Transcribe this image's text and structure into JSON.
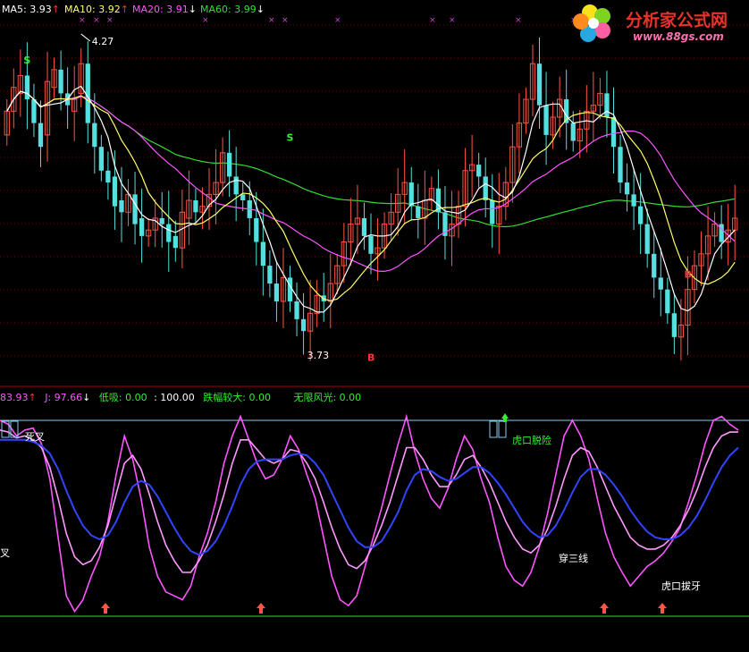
{
  "top_header": {
    "ma5": {
      "label": "MA5: 3.93",
      "arrow": "↑",
      "color": "#ffffff"
    },
    "ma10": {
      "label": "MA10: 3.92",
      "arrow": "↑",
      "color": "#ffff66"
    },
    "ma20": {
      "label": "MA20: 3.91",
      "arrow": "↓",
      "color": "#ff55ff"
    },
    "ma60": {
      "label": "MA60: 3.99",
      "arrow": "↓",
      "color": "#33dd33"
    }
  },
  "logo": {
    "title": "分析家公式网",
    "url": "www.88gs.com"
  },
  "price_panel": {
    "high_label": "4.27",
    "low_label": "3.73",
    "signals": [
      "S",
      "S",
      "B",
      "B"
    ],
    "ymin": 3.68,
    "ymax": 4.3
  },
  "bottom_header": {
    "k": "83.93",
    "k_arrow": "↑",
    "j": "J: 97.66",
    "j_arrow": "↓",
    "low_suck": "低吸: 0.00",
    "hundred": ": 100.00",
    "drop": "跌幅较大: 0.00",
    "wuxian": "无限风光: 0.00"
  },
  "annotations": {
    "sicha": "死叉",
    "cha_left": "叉",
    "hukou_tuoxian": "虎口脱险",
    "chuansanxian": "穿三线",
    "hukou_baya": "虎口拔牙"
  },
  "chart_data": [
    {
      "type": "candlestick",
      "title": "",
      "ylim": [
        3.68,
        4.3
      ],
      "grid": "horizontal dotted red lines",
      "series": [
        {
          "name": "MA5",
          "color": "#ffffff"
        },
        {
          "name": "MA10",
          "color": "#ffff66"
        },
        {
          "name": "MA20",
          "color": "#ff55ff"
        },
        {
          "name": "MA60",
          "color": "#33dd33"
        }
      ],
      "close": [
        4.14,
        4.18,
        4.2,
        4.16,
        4.12,
        4.08,
        4.19,
        4.21,
        4.17,
        4.15,
        4.16,
        4.22,
        4.12,
        4.08,
        4.04,
        4.02,
        3.98,
        3.97,
        4.0,
        3.95,
        3.93,
        3.94,
        3.96,
        3.95,
        3.92,
        3.91,
        3.97,
        3.99,
        3.97,
        3.98,
        4.0,
        4.02,
        4.07,
        4.03,
        4.0,
        3.99,
        3.96,
        3.92,
        3.88,
        3.85,
        3.82,
        3.86,
        3.82,
        3.79,
        3.77,
        3.8,
        3.83,
        3.82,
        3.85,
        3.88,
        3.92,
        3.95,
        3.96,
        3.93,
        3.9,
        3.91,
        3.95,
        3.97,
        4.0,
        4.02,
        3.98,
        3.96,
        3.99,
        4.01,
        3.97,
        3.93,
        3.95,
        3.98,
        4.04,
        4.05,
        4.03,
        3.99,
        3.95,
        3.98,
        4.02,
        4.08,
        4.12,
        4.16,
        4.22,
        4.15,
        4.1,
        4.13,
        4.16,
        4.12,
        4.09,
        4.11,
        4.14,
        4.15,
        4.17,
        4.13,
        4.08,
        4.02,
        4.0,
        3.98,
        3.95,
        3.9,
        3.86,
        3.84,
        3.8,
        3.76,
        3.78,
        3.84,
        3.88,
        3.9,
        3.93,
        3.95,
        3.92,
        3.94,
        3.96
      ],
      "open": [
        4.1,
        4.14,
        4.17,
        4.2,
        4.16,
        4.12,
        4.1,
        4.18,
        4.21,
        4.17,
        4.14,
        4.17,
        4.22,
        4.12,
        4.08,
        4.04,
        4.03,
        3.99,
        3.97,
        4.0,
        3.96,
        3.93,
        3.94,
        3.96,
        3.95,
        3.93,
        3.91,
        3.96,
        3.99,
        3.97,
        3.98,
        4.0,
        4.02,
        4.07,
        4.03,
        4.0,
        3.99,
        3.96,
        3.92,
        3.88,
        3.85,
        3.82,
        3.86,
        3.82,
        3.79,
        3.77,
        3.8,
        3.83,
        3.82,
        3.85,
        3.88,
        3.92,
        3.95,
        3.96,
        3.93,
        3.9,
        3.91,
        3.95,
        3.97,
        4.0,
        4.02,
        3.98,
        3.96,
        3.99,
        4.01,
        3.97,
        3.93,
        3.95,
        3.98,
        4.04,
        4.05,
        4.03,
        3.99,
        3.95,
        3.98,
        4.02,
        4.08,
        4.12,
        4.16,
        4.22,
        4.15,
        4.1,
        4.13,
        4.16,
        4.12,
        4.09,
        4.11,
        4.14,
        4.15,
        4.17,
        4.13,
        4.08,
        4.02,
        4.0,
        3.98,
        3.95,
        3.9,
        3.86,
        3.84,
        3.8,
        3.76,
        3.78,
        3.84,
        3.88,
        3.9,
        3.93,
        3.95,
        3.92,
        3.94
      ],
      "high_point": 4.27,
      "low_point": 3.73
    },
    {
      "type": "line",
      "title": "",
      "ylim": [
        0,
        100
      ],
      "series": [
        {
          "name": "J",
          "color": "#ff55ff",
          "values": [
            100,
            98,
            92,
            95,
            96,
            88,
            70,
            40,
            10,
            2,
            8,
            20,
            30,
            48,
            72,
            92,
            80,
            60,
            35,
            20,
            12,
            10,
            8,
            15,
            30,
            42,
            58,
            78,
            92,
            102,
            90,
            78,
            70,
            72,
            80,
            92,
            85,
            72,
            60,
            40,
            20,
            8,
            5,
            10,
            25,
            40,
            55,
            72,
            88,
            102,
            84,
            70,
            60,
            55,
            65,
            80,
            92,
            85,
            70,
            58,
            40,
            25,
            18,
            15,
            22,
            35,
            52,
            72,
            92,
            100,
            92,
            80,
            60,
            42,
            30,
            22,
            15,
            20,
            25,
            28,
            32,
            38,
            45,
            58,
            72,
            88,
            100,
            102,
            98,
            95
          ]
        },
        {
          "name": "K",
          "color": "#ff99ff",
          "values": [
            95,
            94,
            91,
            92,
            90,
            86,
            76,
            60,
            42,
            30,
            26,
            28,
            35,
            46,
            62,
            78,
            82,
            75,
            62,
            48,
            36,
            28,
            22,
            22,
            28,
            36,
            48,
            62,
            78,
            90,
            90,
            85,
            80,
            78,
            80,
            85,
            84,
            78,
            70,
            58,
            45,
            34,
            26,
            24,
            28,
            36,
            46,
            58,
            72,
            86,
            86,
            80,
            72,
            66,
            66,
            72,
            80,
            82,
            76,
            68,
            58,
            48,
            40,
            34,
            32,
            36,
            44,
            56,
            70,
            82,
            86,
            84,
            76,
            66,
            56,
            48,
            40,
            36,
            34,
            34,
            36,
            40,
            46,
            54,
            64,
            76,
            86,
            92,
            94,
            94
          ]
        },
        {
          "name": "D",
          "color": "#3344ff",
          "values": [
            90,
            90,
            90,
            90,
            89,
            87,
            83,
            75,
            64,
            54,
            46,
            41,
            39,
            41,
            48,
            58,
            66,
            69,
            67,
            61,
            53,
            45,
            38,
            33,
            31,
            33,
            38,
            46,
            56,
            67,
            75,
            79,
            80,
            80,
            80,
            82,
            83,
            82,
            78,
            72,
            63,
            54,
            45,
            38,
            35,
            35,
            38,
            45,
            53,
            64,
            72,
            75,
            74,
            71,
            69,
            70,
            73,
            76,
            76,
            73,
            68,
            62,
            55,
            48,
            43,
            40,
            41,
            46,
            54,
            63,
            71,
            75,
            75,
            72,
            67,
            61,
            54,
            48,
            43,
            40,
            39,
            39,
            41,
            45,
            51,
            59,
            68,
            76,
            82,
            86
          ]
        }
      ],
      "markers": [
        "死叉",
        "虎口脱险",
        "穿三线",
        "虎口拔牙"
      ]
    }
  ]
}
